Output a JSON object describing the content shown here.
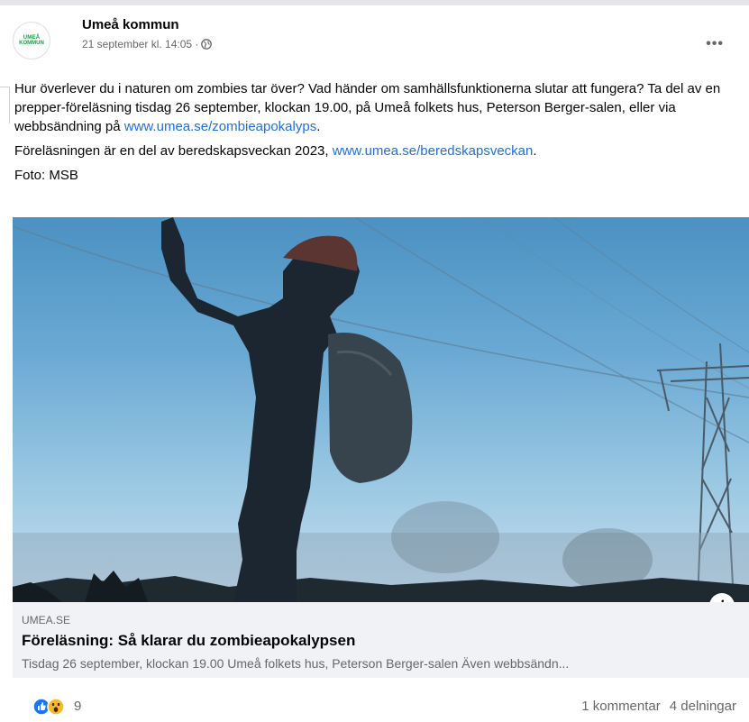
{
  "post": {
    "author": "Umeå kommun",
    "avatar_line1": "UMEÅ",
    "avatar_line2": "KOMMUN",
    "timestamp": "21 september kl. 14:05 ·",
    "more_icon": "more-horizontal-icon",
    "paragraph1_text": "Hur överlever du i naturen om zombies tar över? Vad händer om samhällsfunktionerna slutar att fungera? Ta del av en prepper-föreläsning tisdag 26 september, klockan 19.00, på Umeå folkets hus, Peterson Berger-salen, eller via webbsändning på ",
    "paragraph1_link": "www.umea.se/zombieapokalyps",
    "paragraph1_end": ".",
    "paragraph2_text": "Föreläsningen är en del av beredskapsveckan 2023, ",
    "paragraph2_link": "www.umea.se/beredskapsveckan",
    "paragraph2_end": ".",
    "paragraph3": "Foto: MSB"
  },
  "link_preview": {
    "domain": "UMEA.SE",
    "title": "Föreläsning: Så klarar du zombieapokalypsen",
    "description": "Tisdag 26 september, klockan 19.00 Umeå folkets hus, Peterson Berger-salen Även webbsändn...",
    "info_label": "i"
  },
  "footer": {
    "reaction_count": "9",
    "comments": "1 kommentar",
    "shares": "4 delningar"
  },
  "colors": {
    "link": "#216fdb",
    "like_blue": "#1877f2",
    "wow_yellow": "#f7b928"
  }
}
